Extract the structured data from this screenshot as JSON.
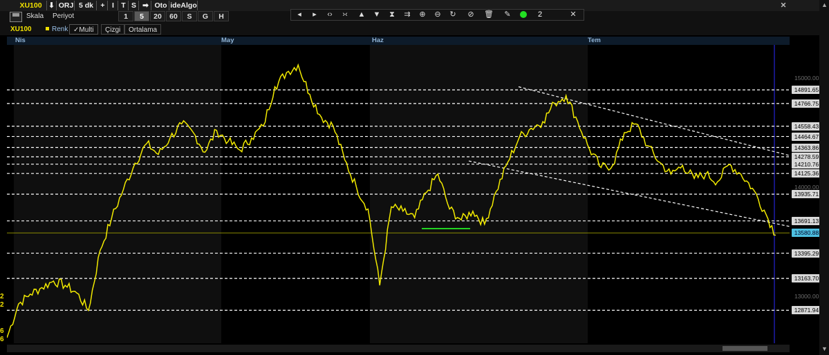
{
  "toolbar": {
    "symbol": "XU100",
    "items": [
      "ORJ",
      "5 dk",
      "+",
      "I",
      "T",
      "S",
      "Oto",
      "ideAlgo"
    ],
    "skala": "Skala",
    "periyot": "Periyot",
    "periods": [
      "1",
      "5",
      "20",
      "60",
      "S",
      "G",
      "H"
    ],
    "active_period": "5",
    "draw_count": "2",
    "close": "✕"
  },
  "legend": {
    "symbol": "XU100",
    "renk": "Renk",
    "multi": "Multi",
    "cizgi": "Çizgi",
    "ortalama": "Ortalama"
  },
  "timeline": [
    "Nis",
    "May",
    "Haz",
    "Tem"
  ],
  "price_axis": {
    "ticks": [
      "15000.00",
      "14000.00",
      "13000.00"
    ],
    "current": "13580.88"
  },
  "side_left": [
    "2",
    "2",
    "6",
    "6"
  ],
  "colors": {
    "line": "#f2ea00",
    "support": "#21d321",
    "level": "#ffffff",
    "current_tag": "#4dbfe0"
  },
  "chart_data": {
    "type": "line",
    "title": "XU100",
    "x": [
      "Nis",
      "May",
      "Haz",
      "Tem"
    ],
    "ylim": [
      12800,
      15200
    ],
    "levels": [
      14891.65,
      14766.75,
      14558.43,
      14464.67,
      14363.86,
      14278.59,
      14210.76,
      14125.36,
      13935.71,
      13691.13,
      13395.29,
      13163.7,
      12871.94
    ],
    "current": 13580.88,
    "series": [
      {
        "values": [
          12620,
          12930,
          13020,
          13080,
          13140,
          13100,
          13030,
          12870,
          13420,
          13720,
          13980,
          14220,
          14400,
          14300,
          14450,
          14580,
          14500,
          14320,
          14520,
          14420,
          14340,
          14450,
          14560,
          14920,
          15050,
          15120,
          14850,
          14640,
          14560,
          14250,
          14000,
          13800,
          13100,
          13820,
          13780,
          13720,
          13950,
          14120,
          13800,
          13700,
          13780,
          13660,
          13960,
          14230,
          14460,
          14540,
          14600,
          14770,
          14840,
          14600,
          14350,
          14180,
          14200,
          14500,
          14580,
          14380,
          14230,
          14120,
          14200,
          14080,
          14120,
          14050,
          14210,
          14120,
          13990,
          13790,
          13560
        ]
      }
    ]
  }
}
